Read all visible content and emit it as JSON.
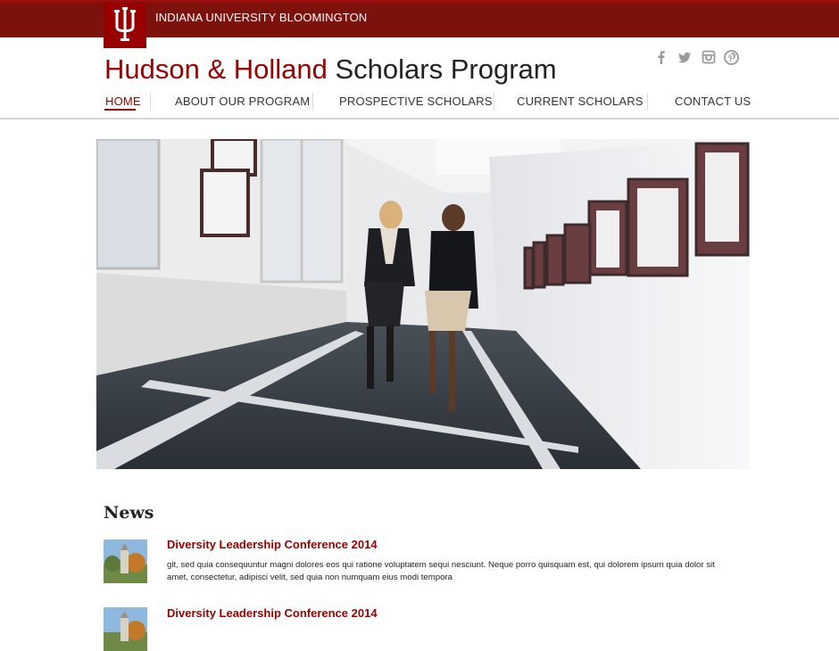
{
  "header": {
    "university": "INDIANA UNIVERSITY BLOOMINGTON",
    "title_red": "Hudson & Holland",
    "title_rest": " Scholars Program"
  },
  "social": [
    "facebook-icon",
    "twitter-icon",
    "instagram-icon",
    "pinterest-icon"
  ],
  "nav": [
    {
      "label": "HOME",
      "active": true
    },
    {
      "label": "ABOUT OUR PROGRAM"
    },
    {
      "label": "PROSPECTIVE SCHOLARS"
    },
    {
      "label": "CURRENT SCHOLARS"
    },
    {
      "label": "CONTACT US"
    }
  ],
  "news": {
    "heading": "News",
    "items": [
      {
        "title": "Diversity Leadership Conference 2014",
        "body": "git, sed quia consequuntur magni dolores eos qui ratione voluptatem sequi nesciunt. Neque porro quisquam est, qui dolorem ipsum quia dolor sit amet, consectetur, adipisci velit, sed quia non numquam eius modi tempora"
      },
      {
        "title": "Diversity Leadership Conference 2014",
        "body": ""
      }
    ]
  },
  "colors": {
    "brand": "#990000",
    "bar": "#7d110c"
  }
}
